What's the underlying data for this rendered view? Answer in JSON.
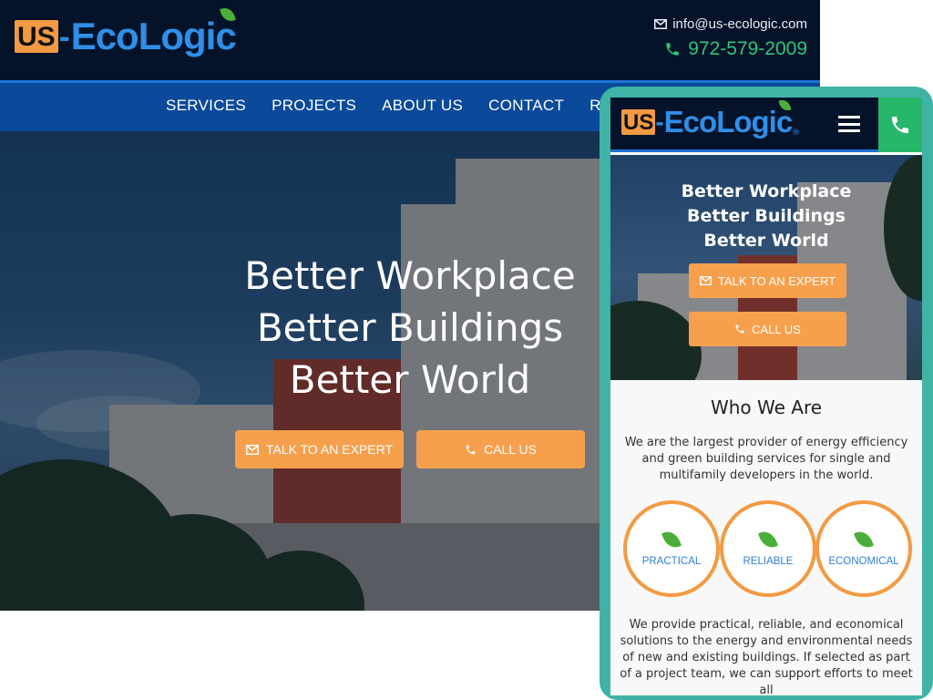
{
  "brand": {
    "logo_us": "US",
    "logo_dash": "-",
    "logo_name": "EcoLogic",
    "registered": "®"
  },
  "contact": {
    "email": "info@us-ecologic.com",
    "phone": "972-579-2009"
  },
  "nav": {
    "items": [
      "SERVICES",
      "PROJECTS",
      "ABOUT US",
      "CONTACT",
      "RESC"
    ]
  },
  "hero": {
    "line1": "Better Workplace",
    "line2": "Better Buildings",
    "line3": "Better World",
    "talk_label": "TALK TO AN EXPERT",
    "call_label": "CALL US"
  },
  "who": {
    "title": "Who We Are",
    "intro": "We are the largest provider of energy efficiency and green building services for single and multifamily developers in the world.",
    "values": [
      "PRACTICAL",
      "RELIABLE",
      "ECONOMICAL"
    ],
    "body": "We provide practical, reliable, and economical solutions to the energy and environmental needs of new and existing buildings. If selected as part of a project team, we can support efforts to meet all"
  },
  "colors": {
    "header_bg": "#04132a",
    "nav_bg": "#0b4a9a",
    "accent_orange": "#f6a04d",
    "phone_green": "#2ec67a",
    "frame_teal": "#3fb3a6",
    "logo_blue": "#2f8fe8"
  },
  "icons": {
    "email": "envelope-icon",
    "phone": "phone-icon",
    "menu": "hamburger-icon",
    "leaf": "leaf-icon"
  }
}
